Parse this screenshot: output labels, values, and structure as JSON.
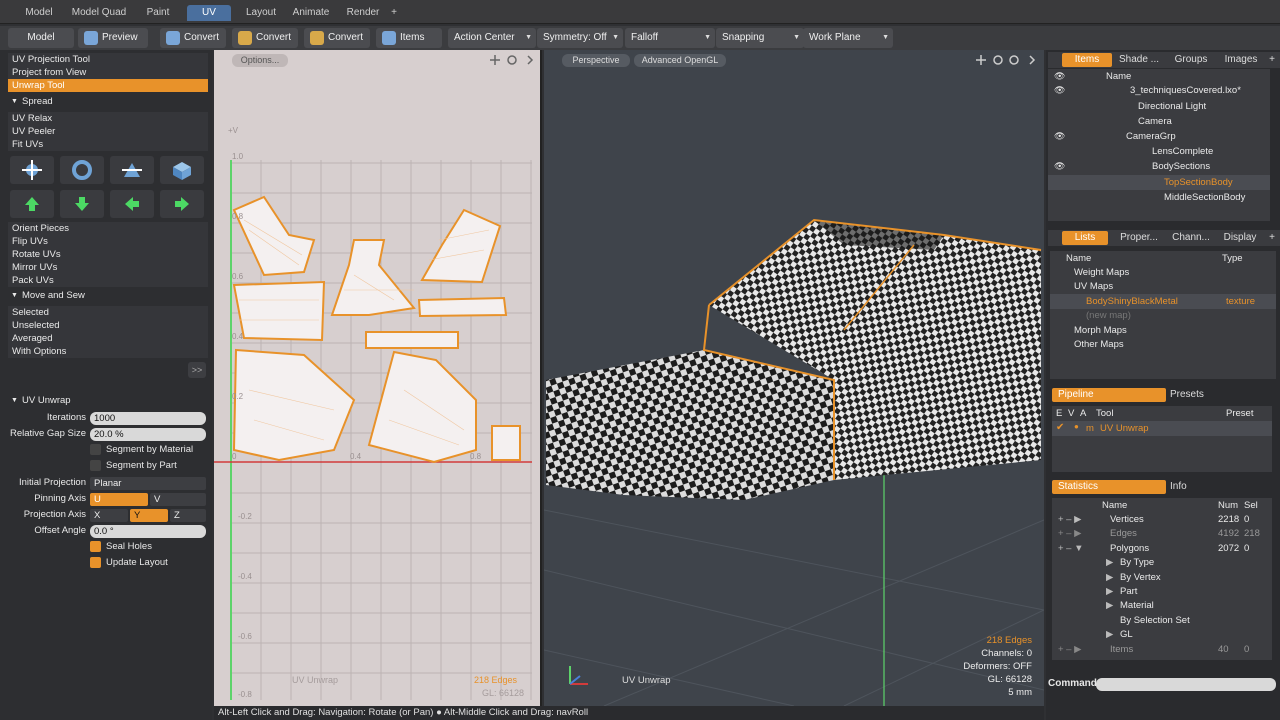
{
  "top_tabs": [
    "Model",
    "Model Quad",
    "Paint",
    "UV",
    "Layout",
    "Animate",
    "Render",
    "+"
  ],
  "toolbar": {
    "model": "Model",
    "preview": "Preview",
    "convert1": "Convert",
    "convert2": "Convert",
    "convert3": "Convert",
    "items": "Items",
    "action_center": "Action Center",
    "symmetry": "Symmetry: Off",
    "falloff": "Falloff",
    "snapping": "Snapping",
    "work_plane": "Work Plane"
  },
  "left": {
    "tools_top": [
      "UV Projection Tool",
      "Project from View",
      "Unwrap Tool"
    ],
    "spread": "Spread",
    "tools_mid": [
      "UV Relax",
      "UV Peeler",
      "Fit UVs"
    ],
    "tools_orient": [
      "Orient Pieces",
      "Flip UVs",
      "Rotate UVs",
      "Mirror UVs",
      "Pack UVs"
    ],
    "move_sew": "Move and Sew",
    "sew_items": [
      "Selected",
      "Unselected",
      "Averaged",
      "With Options"
    ],
    "expand_btn": ">>",
    "unwrap_header": "UV Unwrap",
    "iterations_label": "Iterations",
    "iterations": "1000",
    "gap_label": "Relative Gap Size",
    "gap": "20.0 %",
    "seg_material": "Segment by Material",
    "seg_part": "Segment by Part",
    "init_proj_label": "Initial Projection",
    "init_proj": "Planar",
    "pin_axis_label": "Pinning Axis",
    "pin_u": "U",
    "pin_v": "V",
    "proj_axis_label": "Projection Axis",
    "proj_x": "X",
    "proj_y": "Y",
    "proj_z": "Z",
    "offset_label": "Offset Angle",
    "offset": "0.0 °",
    "seal_holes": "Seal Holes",
    "update_layout": "Update Layout"
  },
  "uv": {
    "options": "Options...",
    "v_axis": "+V",
    "ticks_y": [
      "1.0",
      "0.8",
      "0.6",
      "0.4",
      "0.2",
      "0",
      "-0.2",
      "-0.4",
      "-0.6",
      "-0.8"
    ],
    "ticks_x": [
      "0.4",
      "0.8"
    ],
    "label": "UV Unwrap",
    "edges": "218 Edges",
    "gl": "GL: 66128"
  },
  "view3d": {
    "perspective": "Perspective",
    "advanced": "Advanced OpenGL",
    "label": "UV Unwrap",
    "edges": "218 Edges",
    "channels": "Channels: 0",
    "deformers": "Deformers: OFF",
    "gl": "GL: 66128",
    "units": "5 mm"
  },
  "right": {
    "item_tabs": [
      "Items",
      "Shade ...",
      "Groups",
      "Images",
      "+"
    ],
    "name_col": "Name",
    "tree": [
      "3_techniquesCovered.lxo*",
      "Directional Light",
      "Camera",
      "CameraGrp",
      "LensComplete",
      "BodySections",
      "TopSectionBody",
      "MiddleSectionBody"
    ],
    "lists_tabs": [
      "Lists",
      "Proper...",
      "Chann...",
      "Display",
      "+"
    ],
    "lists_head": {
      "name": "Name",
      "type": "Type"
    },
    "lists": [
      "Weight Maps",
      "UV Maps",
      "BodyShinyBlackMetal",
      "(new map)",
      "Morph Maps",
      "Other Maps"
    ],
    "texture": "texture",
    "pipeline_tabs": [
      "Pipeline",
      "Presets"
    ],
    "pipe_head": {
      "e": "E",
      "v": "V",
      "a": "A",
      "tool": "Tool",
      "preset": "Preset"
    },
    "pipe_row": "UV Unwrap",
    "pipe_m": "m",
    "stats_tabs": [
      "Statistics",
      "Info"
    ],
    "stats_head": {
      "name": "Name",
      "num": "Num",
      "sel": "Sel"
    },
    "stats": [
      {
        "name": "Vertices",
        "num": "2218",
        "sel": "0"
      },
      {
        "name": "Edges",
        "num": "4192",
        "sel": "218"
      },
      {
        "name": "Polygons",
        "num": "2072",
        "sel": "0"
      },
      {
        "name": "By Type",
        "num": "",
        "sel": ""
      },
      {
        "name": "By Vertex",
        "num": "",
        "sel": ""
      },
      {
        "name": "Part",
        "num": "",
        "sel": ""
      },
      {
        "name": "Material",
        "num": "",
        "sel": ""
      },
      {
        "name": "By Selection Set",
        "num": "",
        "sel": ""
      },
      {
        "name": "GL",
        "num": "",
        "sel": ""
      },
      {
        "name": "Items",
        "num": "40",
        "sel": "0"
      }
    ],
    "command_label": "Command"
  },
  "status": "Alt-Left Click and Drag: Navigation: Rotate (or Pan) ● Alt-Middle Click and Drag: navRoll",
  "colors": {
    "accent": "#e8922a",
    "tab_blue": "#4a6f9e"
  }
}
